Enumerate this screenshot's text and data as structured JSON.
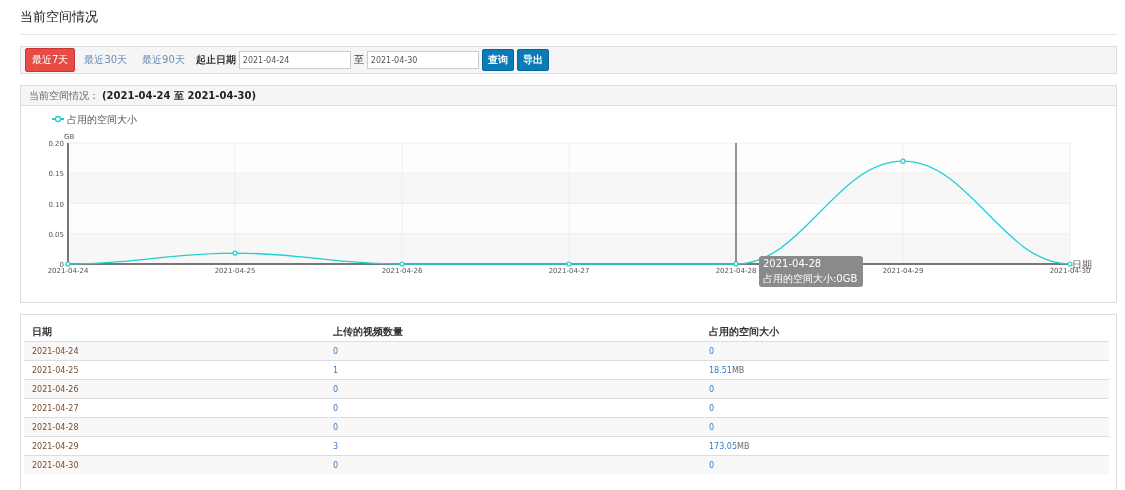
{
  "page_title": "当前空间情况",
  "filter": {
    "quick_ranges": [
      {
        "label": "最近7天",
        "selected": true
      },
      {
        "label": "最近30天",
        "selected": false
      },
      {
        "label": "最近90天",
        "selected": false
      }
    ],
    "date_label": "起止日期",
    "start_date": "2021-04-24",
    "separator": "至",
    "end_date": "2021-04-30",
    "buttons": [
      "查询",
      "导出"
    ]
  },
  "chart_panel": {
    "heading": "当前空间情况：",
    "range": "(2021-04-24 至 2021-04-30)",
    "chart_data": {
      "type": "line",
      "categories": [
        "2021-04-24",
        "2021-04-25",
        "2021-04-26",
        "2021-04-27",
        "2021-04-28",
        "2021-04-29",
        "2021-04-30"
      ],
      "series": [
        {
          "name": "占用的空间大小",
          "color": "#1fcfd0",
          "values": [
            0,
            0.018,
            0,
            0,
            0,
            0.17,
            0
          ]
        }
      ],
      "grid": true,
      "marker": "circle",
      "ref_lines": [
        {
          "axis": "x",
          "value": "2021-04-28",
          "color": "#333333"
        }
      ],
      "ylabel": "GB",
      "xlabel": "日期",
      "ylim": [
        0,
        0.2
      ],
      "yticks": [
        {
          "value": 0,
          "label": "0"
        },
        {
          "value": 0.05,
          "label": "0.05"
        },
        {
          "value": 0.1,
          "label": "0.10"
        },
        {
          "value": 0.15,
          "label": "0.15"
        },
        {
          "value": 0.2,
          "label": "0.20"
        }
      ]
    },
    "tooltip": {
      "title": "2021-04-28",
      "line": "占用的空间大小:0GB"
    }
  },
  "table": {
    "columns": [
      "日期",
      "上传的视频数量",
      "占用的空间大小"
    ],
    "rows": [
      {
        "date": "2021-04-24",
        "count": "0",
        "size": "0"
      },
      {
        "date": "2021-04-25",
        "count": "1",
        "size": "18.51",
        "unit": "MB"
      },
      {
        "date": "2021-04-26",
        "count": "0",
        "size": "0"
      },
      {
        "date": "2021-04-27",
        "count": "0",
        "size": "0"
      },
      {
        "date": "2021-04-28",
        "count": "0",
        "size": "0"
      },
      {
        "date": "2021-04-29",
        "count": "3",
        "size": "173.05",
        "unit": "MB"
      },
      {
        "date": "2021-04-30",
        "count": "0",
        "size": "0"
      }
    ]
  }
}
